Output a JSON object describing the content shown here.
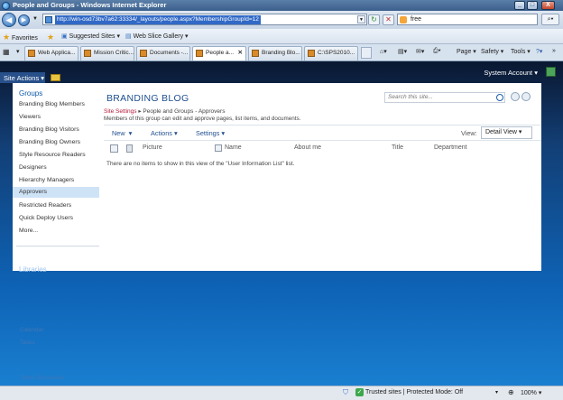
{
  "window": {
    "title": "People and Groups - Windows Internet Explorer",
    "minimize": "_",
    "maximize": "□",
    "close": "X"
  },
  "address": {
    "url": "http://win-osd73bv7a62:33334/_layouts/people.aspx?MembershipGroupId=12",
    "search_value": "free"
  },
  "favorites": {
    "label": "Favorites",
    "suggested": "Suggested Sites",
    "webslice": "Web Slice Gallery"
  },
  "tabs": [
    {
      "label": "Web Applica..."
    },
    {
      "label": "Mission Critic..."
    },
    {
      "label": "Documents -..."
    },
    {
      "label": "People a..."
    },
    {
      "label": "Branding Blo..."
    },
    {
      "label": "C:\\SPS2010..."
    }
  ],
  "commands": {
    "page": "Page",
    "safety": "Safety",
    "tools": "Tools"
  },
  "sp": {
    "system_account": "System Account",
    "site_actions": "Site Actions"
  },
  "left_nav": {
    "heading": "Groups",
    "items": [
      "Branding Blog Members",
      "Viewers",
      "Branding Blog Visitors",
      "Branding Blog Owners",
      "Style Resource Readers",
      "Designers",
      "Hierarchy Managers",
      "Approvers",
      "Restricted Readers",
      "Quick Deploy Users",
      "More..."
    ],
    "active_index": 7,
    "libraries": "Libraries",
    "faint_items": [
      "Calendar",
      "Tasks",
      "Team Discussion"
    ]
  },
  "main": {
    "heading": "BRANDING BLOG",
    "breadcrumb_link": "Site Settings",
    "breadcrumb_sep": "▸",
    "breadcrumb_rest": "People and Groups - Approvers",
    "description": "Members of this group can edit and approve pages, list items, and documents.",
    "search_placeholder": "Search this site...",
    "toolbar": {
      "new": "New",
      "actions": "Actions",
      "settings": "Settings",
      "view_label": "View:",
      "view_value": "Detail View"
    },
    "columns": {
      "picture": "Picture",
      "name": "Name",
      "about": "About me",
      "title": "Title",
      "department": "Department"
    },
    "empty_message": "There are no items to show in this view of the \"User Information List\" list."
  },
  "status": {
    "zone": "Trusted sites | Protected Mode: Off",
    "zoom": "100%"
  }
}
